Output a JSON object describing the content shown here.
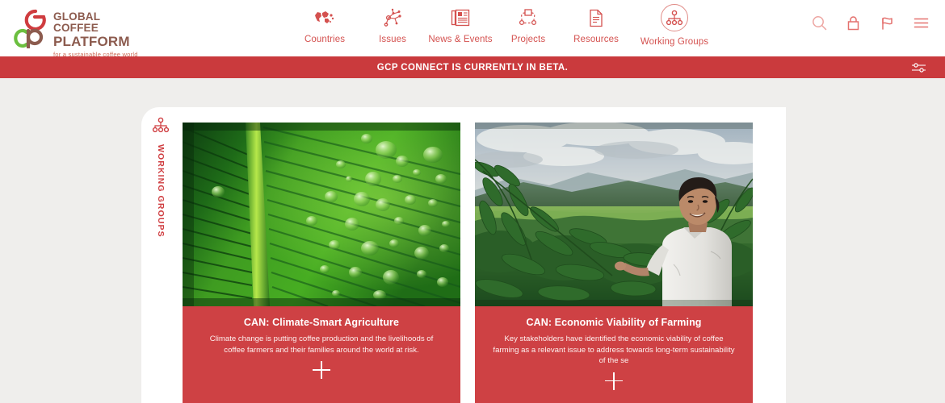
{
  "brand": {
    "logo_line1": "GLOBAL COFFEE",
    "logo_line2": "PLATFORM",
    "tagline": "for a sustainable coffee world",
    "logo_red": "#cf3c3f",
    "logo_green": "#6bbf3f",
    "logo_brown": "#8c5b4e"
  },
  "nav": {
    "items": [
      {
        "label": "Countries",
        "icon": "world-map-icon",
        "active": false
      },
      {
        "label": "Issues",
        "icon": "network-nodes-icon",
        "active": false
      },
      {
        "label": "News & Events",
        "icon": "newspaper-icon",
        "active": false
      },
      {
        "label": "Projects",
        "icon": "project-diagram-icon",
        "active": false
      },
      {
        "label": "Resources",
        "icon": "document-icon",
        "active": false
      },
      {
        "label": "Working Groups",
        "icon": "working-groups-icon",
        "active": true
      }
    ]
  },
  "tools": [
    {
      "name": "search-icon",
      "label": "Search"
    },
    {
      "name": "lock-icon",
      "label": "Login"
    },
    {
      "name": "flag-icon",
      "label": "Language"
    },
    {
      "name": "hamburger-menu-icon",
      "label": "Menu"
    }
  ],
  "banner": {
    "text": "GCP CONNECT IS CURRENTLY IN BETA.",
    "background": "#ca3a3d",
    "settings_icon": "sliders-icon"
  },
  "sidebar": {
    "tab_label": "WORKING GROUPS",
    "tab_icon": "working-groups-icon"
  },
  "cards": [
    {
      "title": "CAN: Climate-Smart Agriculture",
      "description": "Climate change is putting coffee production and the livelihoods of coffee farmers and their families around the world at risk.",
      "image": "green-leaf-with-water-droplets",
      "expand_icon": "plus-icon",
      "background": "#ce4144"
    },
    {
      "title": "CAN: Economic Viability of Farming",
      "description": "Key stakeholders have identified the economic viability of coffee farming as a relevant issue to address towards long-term sustainability of the se",
      "image": "coffee-farmer-in-plantation",
      "expand_icon": "plus-icon",
      "background": "#ce4144"
    }
  ],
  "page": {
    "background": "#efeeec",
    "panel_background": "#ffffff"
  }
}
